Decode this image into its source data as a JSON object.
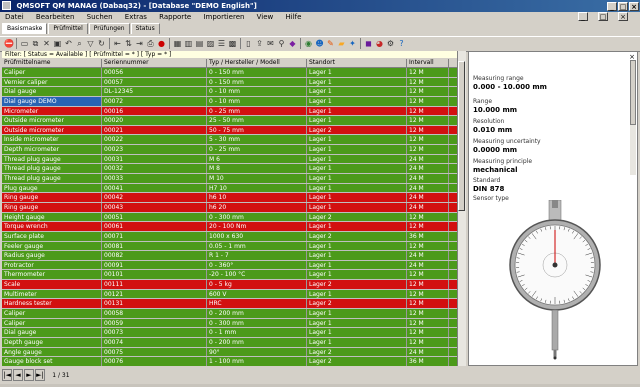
{
  "window": {
    "title": "QMSOFT QM MANAG (Dabaq32) - [Database \"DEMO English\"]"
  },
  "menu": [
    "Datei",
    "Bearbeiten",
    "Suchen",
    "Extras",
    "Rapporte",
    "Importieren",
    "View",
    "Hilfe"
  ],
  "tabs": [
    "Basismaske",
    "Prüfmittel",
    "Prüfungen",
    "Status"
  ],
  "filter": "Filter: [ Status = Available ] [ Prüfmittel = * ] [ Typ = * ]",
  "columns": [
    "Prüfmittelname",
    "Seriennummer",
    "Typ / Hersteller / Modell",
    "Standort",
    "Intervall"
  ],
  "rows": [
    {
      "c": [
        "Caliper",
        "00056",
        "0 - 150 mm",
        "Lager 1",
        "12 M"
      ],
      "color": "green"
    },
    {
      "c": [
        "Vernier caliper",
        "00057",
        "0 - 150 mm",
        "Lager 1",
        "12 M"
      ],
      "color": "green"
    },
    {
      "c": [
        "Dial gauge",
        "DL-12345",
        "0 - 10 mm",
        "Lager 1",
        "12 M"
      ],
      "color": "green"
    },
    {
      "c": [
        "Dial gauge DEMO",
        "00072",
        "0 - 10 mm",
        "Lager 1",
        "12 M"
      ],
      "color": "green",
      "sel": true
    },
    {
      "c": [
        "Micrometer",
        "00016",
        "0 - 25 mm",
        "Lager 1",
        "12 M"
      ],
      "color": "red"
    },
    {
      "c": [
        "Outside micrometer",
        "00020",
        "25 - 50 mm",
        "Lager 1",
        "12 M"
      ],
      "color": "green"
    },
    {
      "c": [
        "Outside micrometer",
        "00021",
        "50 - 75 mm",
        "Lager 2",
        "12 M"
      ],
      "color": "red"
    },
    {
      "c": [
        "Inside micrometer",
        "00022",
        "5 - 30 mm",
        "Lager 1",
        "12 M"
      ],
      "color": "green"
    },
    {
      "c": [
        "Depth micrometer",
        "00023",
        "0 - 25 mm",
        "Lager 1",
        "12 M"
      ],
      "color": "green"
    },
    {
      "c": [
        "Thread plug gauge",
        "00031",
        "M 6",
        "Lager 1",
        "24 M"
      ],
      "color": "green"
    },
    {
      "c": [
        "Thread plug gauge",
        "00032",
        "M 8",
        "Lager 1",
        "24 M"
      ],
      "color": "green"
    },
    {
      "c": [
        "Thread plug gauge",
        "00033",
        "M 10",
        "Lager 1",
        "24 M"
      ],
      "color": "green"
    },
    {
      "c": [
        "Plug gauge",
        "00041",
        "H7 10",
        "Lager 1",
        "24 M"
      ],
      "color": "green"
    },
    {
      "c": [
        "Ring gauge",
        "00042",
        "h6 10",
        "Lager 1",
        "24 M"
      ],
      "color": "red"
    },
    {
      "c": [
        "Ring gauge",
        "00043",
        "h6 20",
        "Lager 1",
        "24 M"
      ],
      "color": "red"
    },
    {
      "c": [
        "Height gauge",
        "00051",
        "0 - 300 mm",
        "Lager 2",
        "12 M"
      ],
      "color": "green"
    },
    {
      "c": [
        "Torque wrench",
        "00061",
        "20 - 100 Nm",
        "Lager 1",
        "12 M"
      ],
      "color": "red"
    },
    {
      "c": [
        "Surface plate",
        "00071",
        "1000 x 630",
        "Lager 2",
        "36 M"
      ],
      "color": "green"
    },
    {
      "c": [
        "Feeler gauge",
        "00081",
        "0.05 - 1 mm",
        "Lager 1",
        "12 M"
      ],
      "color": "green"
    },
    {
      "c": [
        "Radius gauge",
        "00082",
        "R 1 - 7",
        "Lager 1",
        "24 M"
      ],
      "color": "green"
    },
    {
      "c": [
        "Protractor",
        "00091",
        "0 - 360°",
        "Lager 1",
        "24 M"
      ],
      "color": "green"
    },
    {
      "c": [
        "Thermometer",
        "00101",
        "-20 - 100 °C",
        "Lager 1",
        "12 M"
      ],
      "color": "green"
    },
    {
      "c": [
        "Scale",
        "00111",
        "0 - 5 kg",
        "Lager 2",
        "12 M"
      ],
      "color": "red"
    },
    {
      "c": [
        "Multimeter",
        "00121",
        "600 V",
        "Lager 1",
        "12 M"
      ],
      "color": "green"
    },
    {
      "c": [
        "Hardness tester",
        "00131",
        "HRC",
        "Lager 2",
        "12 M"
      ],
      "color": "red"
    },
    {
      "c": [
        "Caliper",
        "00058",
        "0 - 200 mm",
        "Lager 1",
        "12 M"
      ],
      "color": "green"
    },
    {
      "c": [
        "Caliper",
        "00059",
        "0 - 300 mm",
        "Lager 1",
        "12 M"
      ],
      "color": "green"
    },
    {
      "c": [
        "Dial gauge",
        "00073",
        "0 - 1 mm",
        "Lager 1",
        "12 M"
      ],
      "color": "green"
    },
    {
      "c": [
        "Depth gauge",
        "00074",
        "0 - 200 mm",
        "Lager 1",
        "12 M"
      ],
      "color": "green"
    },
    {
      "c": [
        "Angle gauge",
        "00075",
        "90°",
        "Lager 2",
        "24 M"
      ],
      "color": "green"
    },
    {
      "c": [
        "Gauge block set",
        "00076",
        "1 - 100 mm",
        "Lager 2",
        "36 M"
      ],
      "color": "green"
    }
  ],
  "side": {
    "lbl1": "Measuring range",
    "val1": "0.000 - 10.000 mm",
    "lbl2": "Range",
    "val2": "10.000 mm",
    "lbl3": "Resolution",
    "val3": "0.010 mm",
    "lbl4": "Measuring uncertainty",
    "val4": "0.0000 mm",
    "lbl5": "Measuring principle",
    "val5": "mechanical",
    "lbl6": "Standard",
    "val6": "DIN 878",
    "lbl7": "Sensor type",
    "val7": ""
  },
  "nav": {
    "record": "1 / 31"
  },
  "colors": {
    "green": "#4c9a1a",
    "red": "#d21010",
    "selected": "#2864b4"
  }
}
